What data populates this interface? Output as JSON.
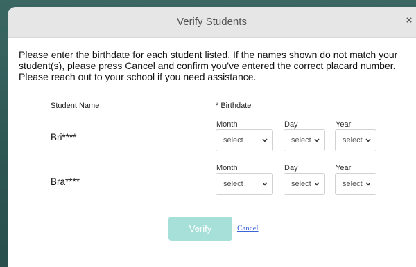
{
  "dialog": {
    "title": "Verify Students",
    "close_symbol": "×",
    "instructions": "Please enter the birthdate for each student listed. If the names shown do not match your student(s), please press Cancel and confirm you've entered the correct placard number. Please reach out to your school if you need assistance."
  },
  "table": {
    "student_name_header": "Student Name",
    "birthdate_header": "* Birthdate",
    "students": [
      {
        "name": "Bri****",
        "month_label": "Month",
        "day_label": "Day",
        "year_label": "Year",
        "month_value": "select",
        "day_value": "select",
        "year_value": "select"
      },
      {
        "name": "Bra****",
        "month_label": "Month",
        "day_label": "Day",
        "year_label": "Year",
        "month_value": "select",
        "day_value": "select",
        "year_value": "select"
      }
    ]
  },
  "actions": {
    "verify_label": "Verify",
    "cancel_label": "Cancel"
  },
  "icons": {
    "close": "close-icon",
    "dropdown": "chevron-down-icon"
  },
  "colors": {
    "verify_button": "#a7e0d9",
    "cancel_link": "#3c64d6",
    "header_bg": "#e6e6e6",
    "backdrop": "#2f5a57"
  }
}
